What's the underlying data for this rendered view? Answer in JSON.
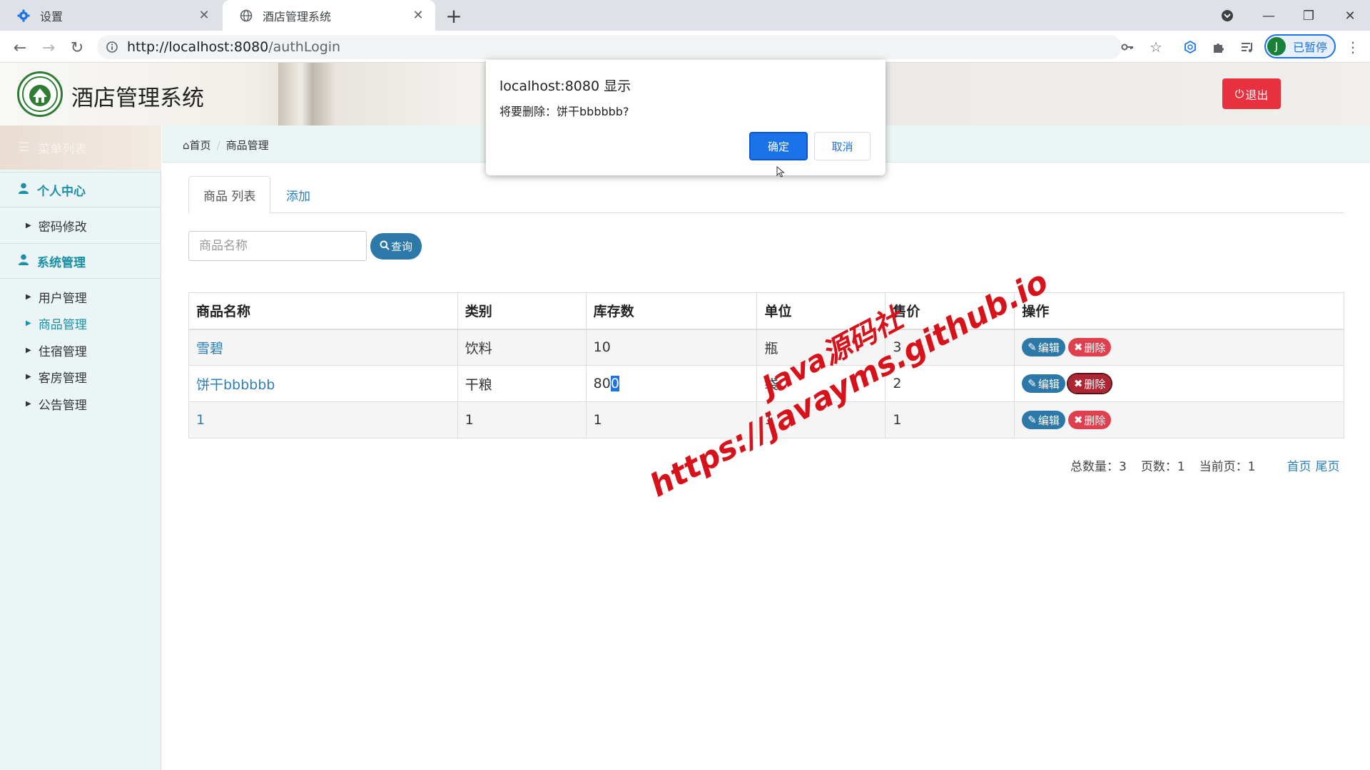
{
  "browser": {
    "tabs": [
      {
        "label": "设置",
        "icon": "gear-icon"
      },
      {
        "label": "酒店管理系统",
        "icon": "globe-icon"
      }
    ],
    "url_host": "http://localhost:8080",
    "url_path": "/authLogin",
    "profile_initial": "J",
    "profile_status": "已暂停"
  },
  "header": {
    "title": "酒店管理系统",
    "logout_label": "退出"
  },
  "sidebar": {
    "menu_header": "菜单列表",
    "sections": [
      {
        "label": "个人中心",
        "items": [
          "密码修改"
        ]
      },
      {
        "label": "系统管理",
        "items": [
          "用户管理",
          "商品管理",
          "住宿管理",
          "客房管理",
          "公告管理"
        ]
      }
    ],
    "active_item": "商品管理"
  },
  "breadcrumb": {
    "home": "首页",
    "current": "商品管理"
  },
  "tabs": {
    "list": "商品 列表",
    "add": "添加"
  },
  "search": {
    "placeholder": "商品名称",
    "button": "查询"
  },
  "table": {
    "columns": [
      "商品名称",
      "类别",
      "库存数",
      "单位",
      "售价",
      "操作"
    ],
    "rows": [
      {
        "name": "雪碧",
        "category": "饮料",
        "stock": "10",
        "unit": "瓶",
        "price": "3"
      },
      {
        "name": "饼干bbbbbb",
        "category": "干粮",
        "stock_a": "80",
        "stock_b": "0",
        "unit": "袋",
        "price": "2"
      },
      {
        "name": "1",
        "category": "1",
        "stock": "1",
        "unit": "1",
        "price": "1"
      }
    ],
    "edit_label": "编辑",
    "delete_label": "删除"
  },
  "pager": {
    "total": "总数量：3",
    "pages": "页数：1",
    "current": "当前页：1",
    "first": "首页",
    "last": "尾页"
  },
  "watermark": {
    "line1": "Java源码社",
    "line2": "https://javayms.github.io"
  },
  "dialog": {
    "title": "localhost:8080 显示",
    "message": "将要删除：饼干bbbbbb?",
    "ok": "确定",
    "cancel": "取消"
  }
}
